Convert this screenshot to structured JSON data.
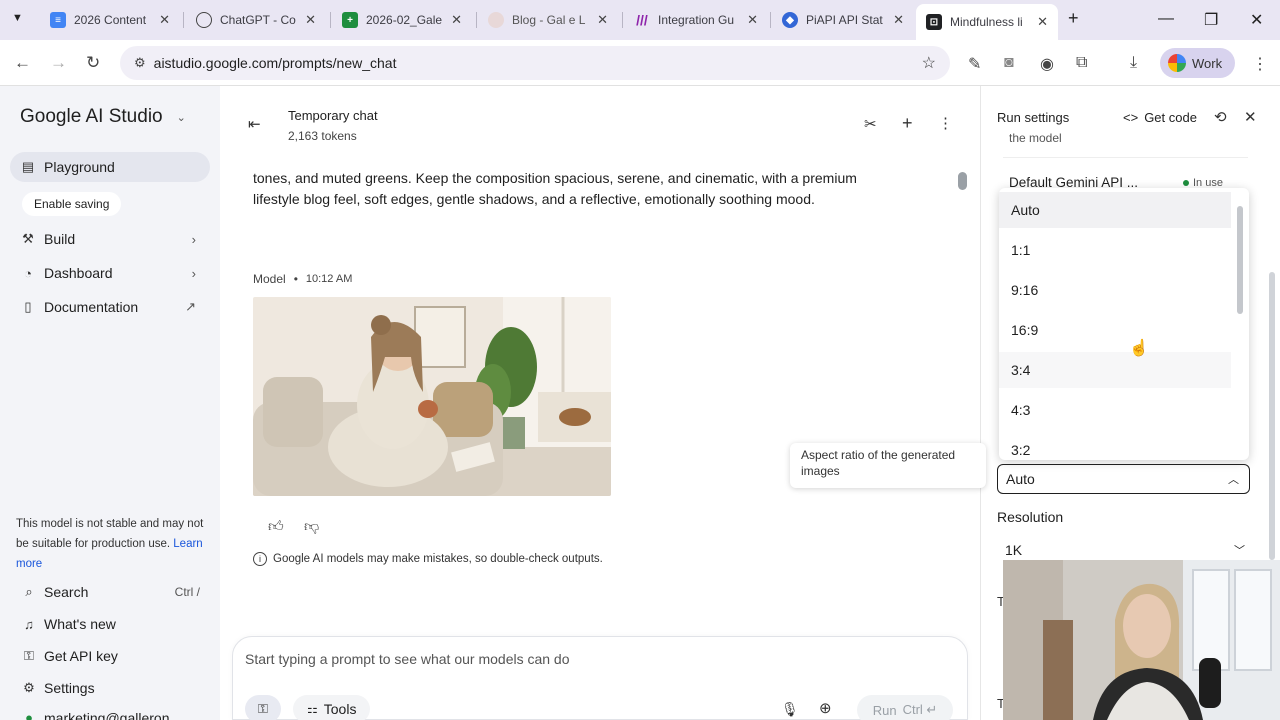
{
  "browser": {
    "tabs": [
      {
        "title": "2026 Content",
        "favicon": "docs-icon",
        "color": "#4285f4"
      },
      {
        "title": "ChatGPT - Co",
        "favicon": "chatgpt-icon",
        "color": "#444444"
      },
      {
        "title": "2026-02_Gale",
        "favicon": "sheets-icon",
        "color": "#1e8e3e"
      },
      {
        "title": "Blog - Gal e L",
        "favicon": "blog-icon",
        "color": "#d9c4c4"
      },
      {
        "title": "Integration Gu",
        "favicon": "make-icon",
        "color": "#8e24aa"
      },
      {
        "title": "PiAPI API Stat",
        "favicon": "piapi-icon",
        "color": "#3367d6"
      },
      {
        "title": "Mindfulness li",
        "favicon": "aistudio-icon",
        "color": "#202124"
      }
    ],
    "url": "aistudio.google.com/prompts/new_chat",
    "profile_label": "Work"
  },
  "sidebar": {
    "brand": "Google AI Studio",
    "items": [
      {
        "label": "Playground",
        "icon": "playground-icon"
      },
      {
        "label": "Build",
        "icon": "build-icon"
      },
      {
        "label": "Dashboard",
        "icon": "dashboard-icon"
      },
      {
        "label": "Documentation",
        "icon": "documentation-icon"
      }
    ],
    "enable_saving": "Enable saving",
    "warning": "This model is not stable and may not be suitable for production use.",
    "learn_more": "Learn more",
    "bottom_items": [
      {
        "label": "Search",
        "shortcut": "Ctrl /",
        "icon": "search-icon"
      },
      {
        "label": "What's new",
        "icon": "bell-icon"
      },
      {
        "label": "Get API key",
        "icon": "key-icon"
      },
      {
        "label": "Settings",
        "icon": "gear-icon"
      }
    ],
    "account": "marketing@galleron"
  },
  "chat": {
    "title": "Temporary chat",
    "tokens": "2,163 tokens",
    "prompt_line1": "tones, and muted greens. Keep the composition spacious, serene, and cinematic, with a premium",
    "prompt_line2": "lifestyle blog feel, soft edges, gentle shadows, and a reflective, emotionally soothing mood.",
    "model_label": "Model",
    "time": "10:12 AM",
    "disclaimer": "Google AI models may make mistakes, so double-check outputs.",
    "input_placeholder": "Start typing a prompt to see what our models can do",
    "tools_label": "Tools",
    "run_label": "Run",
    "run_shortcut": "Ctrl ↵"
  },
  "run_settings": {
    "title": "Run settings",
    "get_code": "Get code",
    "model_fragment": "the model",
    "api_key_label": "Default Gemini API ...",
    "in_use": "In use",
    "aspect_options": [
      "Auto",
      "1:1",
      "9:16",
      "16:9",
      "3:4",
      "4:3",
      "3:2"
    ],
    "aspect_selected": "Auto",
    "aspect_tooltip": "Aspect ratio of the generated images",
    "resolution_label": "Resolution",
    "resolution_value": "1K",
    "frag_a": "T",
    "frag_b": "T"
  }
}
